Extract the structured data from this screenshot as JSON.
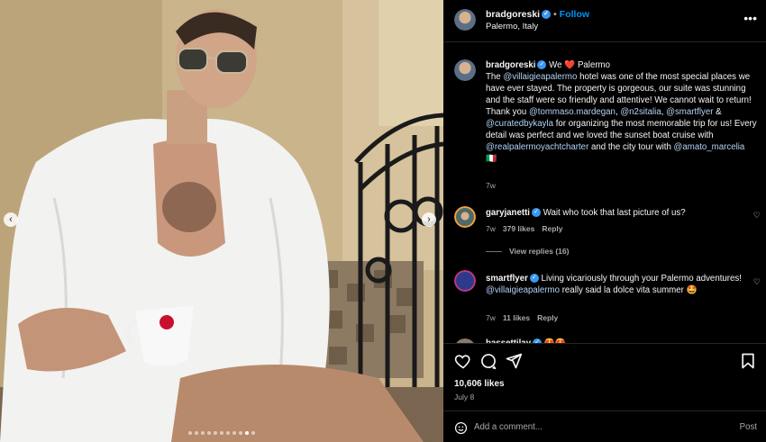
{
  "post": {
    "author": "bradgoreski",
    "follow_label": "Follow",
    "separator": "•",
    "location": "Palermo, Italy"
  },
  "caption": {
    "user": "bradgoreski",
    "line1_rest": " We ❤️ Palermo",
    "p1_a": "The ",
    "m1": "@villaigieapalermo",
    "p1_b": " hotel was one of the most special places we have ever stayed. The property is gorgeous, our suite was stunning and the staff were so friendly and attentive! We cannot wait to return!",
    "p2_a": "Thank you ",
    "m2": "@tommaso.mardegan",
    "p2_b": ", ",
    "m3": "@n2sitalia",
    "p2_c": ", ",
    "m4": "@smartflyer",
    "p2_d": " & ",
    "m5": "@curatedbykayla",
    "p2_e": " for organizing the most memorable trip for us! Every detail was perfect and we loved the sunset boat cruise with ",
    "m6": "@realpalermoyachtcharter",
    "p2_f": " and the city tour with ",
    "m7": "@amato_marcelia",
    "flag": " 🇮🇹",
    "time": "7w"
  },
  "comments": [
    {
      "user": "garyjanetti",
      "text": " Wait who took that last picture of us?",
      "time": "7w",
      "likes": "379 likes",
      "reply": "Reply"
    },
    {
      "user": "smartflyer",
      "text_a": " Living vicariously through your Palermo adventures! ",
      "mention": "@villaigieapalermo",
      "text_b": " really said la dolce vita summer 🤩",
      "time": "7w",
      "likes": "11 likes",
      "reply": "Reply"
    },
    {
      "user": "bassettilav",
      "text": "😍😍"
    }
  ],
  "view_replies": "View replies (16)",
  "likes_count": "10,606 likes",
  "post_date": "July 8",
  "add_comment_placeholder": "Add a comment...",
  "post_label": "Post",
  "nav": {
    "prev": "‹",
    "next": "›"
  },
  "carousel": {
    "total": 11,
    "active_index": 9
  },
  "colors": {
    "accent": "#0095f6",
    "mention": "#b3d4f5",
    "muted": "#a8a8a8",
    "background": "#000000"
  },
  "icons": [
    "verified-badge-icon",
    "more-options-icon",
    "heart-icon",
    "comment-icon",
    "share-icon",
    "bookmark-icon",
    "emoji-icon"
  ]
}
